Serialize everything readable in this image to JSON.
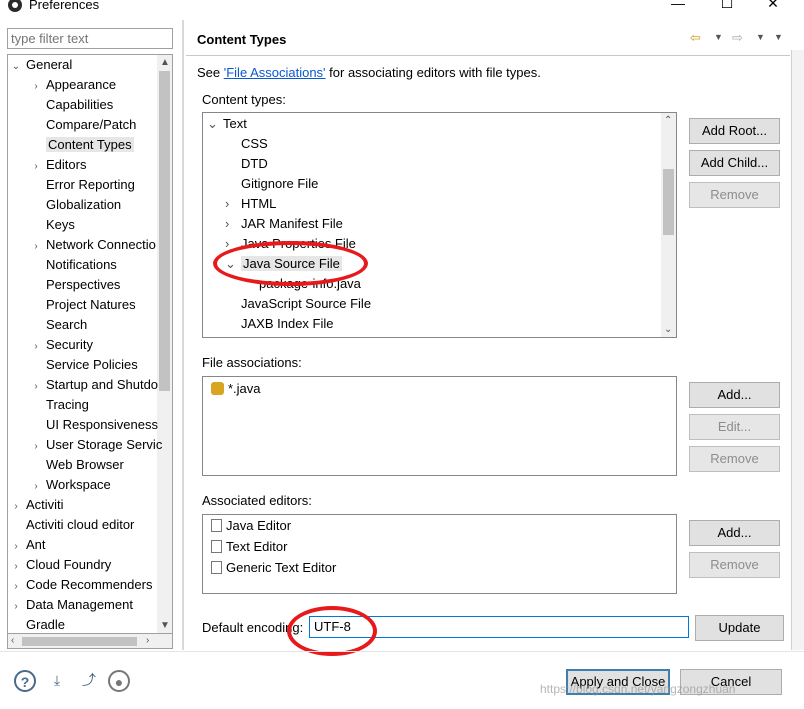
{
  "window": {
    "title": "Preferences",
    "minimize": "—",
    "maximize": "☐",
    "close": "✕"
  },
  "filter": {
    "placeholder": "type filter text"
  },
  "tree": [
    {
      "label": "General",
      "level": 0,
      "toggle": "⌄"
    },
    {
      "label": "Appearance",
      "level": 1,
      "toggle": "›"
    },
    {
      "label": "Capabilities",
      "level": 1,
      "toggle": ""
    },
    {
      "label": "Compare/Patch",
      "level": 1,
      "toggle": ""
    },
    {
      "label": "Content Types",
      "level": 1,
      "toggle": "",
      "selected": true
    },
    {
      "label": "Editors",
      "level": 1,
      "toggle": "›"
    },
    {
      "label": "Error Reporting",
      "level": 1,
      "toggle": ""
    },
    {
      "label": "Globalization",
      "level": 1,
      "toggle": ""
    },
    {
      "label": "Keys",
      "level": 1,
      "toggle": ""
    },
    {
      "label": "Network Connectio",
      "level": 1,
      "toggle": "›"
    },
    {
      "label": "Notifications",
      "level": 1,
      "toggle": ""
    },
    {
      "label": "Perspectives",
      "level": 1,
      "toggle": ""
    },
    {
      "label": "Project Natures",
      "level": 1,
      "toggle": ""
    },
    {
      "label": "Search",
      "level": 1,
      "toggle": ""
    },
    {
      "label": "Security",
      "level": 1,
      "toggle": "›"
    },
    {
      "label": "Service Policies",
      "level": 1,
      "toggle": ""
    },
    {
      "label": "Startup and Shutdo",
      "level": 1,
      "toggle": "›"
    },
    {
      "label": "Tracing",
      "level": 1,
      "toggle": ""
    },
    {
      "label": "UI Responsiveness",
      "level": 1,
      "toggle": ""
    },
    {
      "label": "User Storage Servic",
      "level": 1,
      "toggle": "›"
    },
    {
      "label": "Web Browser",
      "level": 1,
      "toggle": ""
    },
    {
      "label": "Workspace",
      "level": 1,
      "toggle": "›"
    },
    {
      "label": "Activiti",
      "level": 0,
      "toggle": "›"
    },
    {
      "label": "Activiti cloud editor",
      "level": 0,
      "toggle": ""
    },
    {
      "label": "Ant",
      "level": 0,
      "toggle": "›"
    },
    {
      "label": "Cloud Foundry",
      "level": 0,
      "toggle": "›"
    },
    {
      "label": "Code Recommenders",
      "level": 0,
      "toggle": "›"
    },
    {
      "label": "Data Management",
      "level": 0,
      "toggle": "›"
    },
    {
      "label": "Gradle",
      "level": 0,
      "toggle": ""
    }
  ],
  "panel": {
    "title": "Content Types",
    "see_prefix": "See ",
    "see_link": "'File Associations'",
    "see_suffix": " for associating editors with file types.",
    "content_types_label": "Content types:",
    "file_assoc_label": "File associations:",
    "assoc_editors_label": "Associated editors:",
    "encoding_label": "Default encoding:",
    "encoding_value": "UTF-8"
  },
  "content_types": [
    {
      "label": "Text",
      "indent": 0,
      "toggle": "⌄"
    },
    {
      "label": "CSS",
      "indent": 1,
      "toggle": ""
    },
    {
      "label": "DTD",
      "indent": 1,
      "toggle": ""
    },
    {
      "label": "Gitignore File",
      "indent": 1,
      "toggle": ""
    },
    {
      "label": "HTML",
      "indent": 1,
      "toggle": "›"
    },
    {
      "label": "JAR Manifest File",
      "indent": 1,
      "toggle": "›"
    },
    {
      "label": "Java Properties File",
      "indent": 1,
      "toggle": "›"
    },
    {
      "label": "Java Source File",
      "indent": 1,
      "toggle": "⌄",
      "selected": true
    },
    {
      "label": "package-info.java",
      "indent": 2,
      "toggle": ""
    },
    {
      "label": "JavaScript Source File",
      "indent": 1,
      "toggle": ""
    },
    {
      "label": "JAXB Index File",
      "indent": 1,
      "toggle": ""
    }
  ],
  "file_associations": [
    "*.java"
  ],
  "editors": [
    {
      "label": "Java Editor",
      "icon": "java-editor-icon"
    },
    {
      "label": "Text Editor",
      "icon": "text-editor-icon"
    },
    {
      "label": "Generic Text Editor",
      "icon": "generic-editor-icon"
    }
  ],
  "buttons": {
    "add_root": "Add Root...",
    "add_child": "Add Child...",
    "remove_ct": "Remove",
    "add_fa": "Add...",
    "edit_fa": "Edit...",
    "remove_fa": "Remove",
    "add_ed": "Add...",
    "remove_ed": "Remove",
    "update": "Update",
    "apply_close": "Apply and Close",
    "cancel": "Cancel"
  },
  "watermark": "https://blog.csdn.net/yangzongzhuan"
}
